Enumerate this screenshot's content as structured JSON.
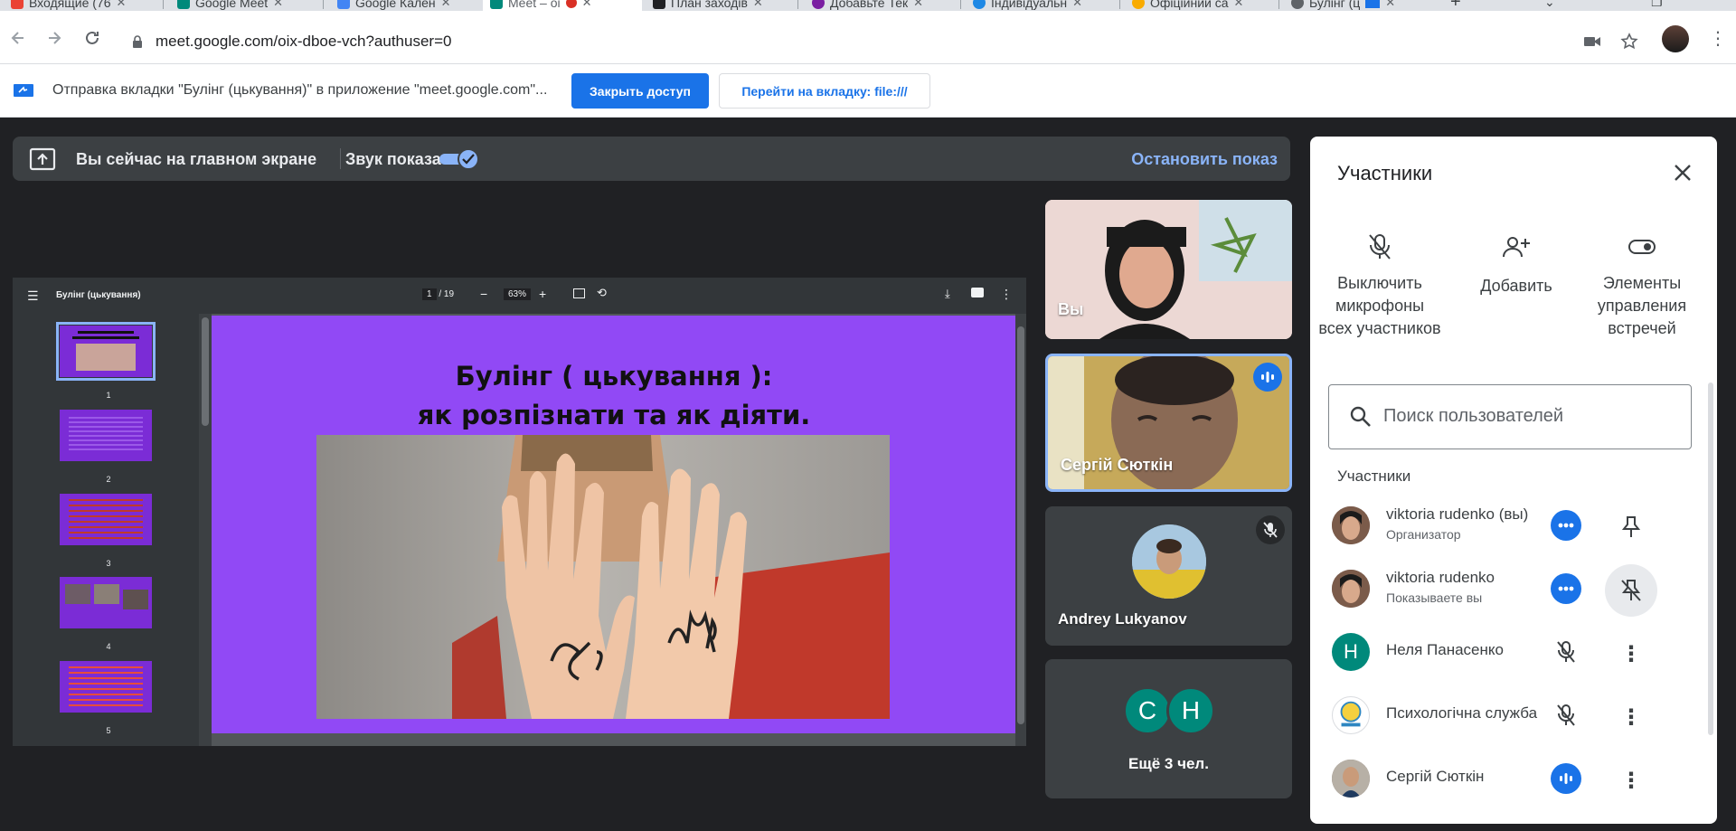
{
  "browser": {
    "tabs": [
      {
        "label": "Входящие (76",
        "color": "#ea4335"
      },
      {
        "label": "Google Meet",
        "color": "#00897b"
      },
      {
        "label": "Google Кален",
        "color": "#4285f4"
      },
      {
        "label": "Meet – oi",
        "color": "#00897b"
      },
      {
        "label": "План заходів",
        "color": "#202124"
      },
      {
        "label": "Добавьте Тек",
        "color": "#7b1fa2"
      },
      {
        "label": "Індивідуальн",
        "color": "#1e88e5"
      },
      {
        "label": "Офіційний са",
        "color": "#f9ab00"
      },
      {
        "label": "Булінг (ц",
        "color": "#5f6368"
      }
    ],
    "url": "meet.google.com/oix-dboe-vch?authuser=0"
  },
  "infobar": {
    "message": "Отправка вкладки \"Булінг (цькування)\" в приложение \"meet.google.com\"...",
    "stop_button": "Закрыть доступ",
    "goto_button": "Перейти на вкладку: file:///"
  },
  "presenting": {
    "status": "Вы сейчас на главном экране",
    "sound_label": "Звук показа",
    "sound_on": true,
    "stop_label": "Остановить показ"
  },
  "pdf": {
    "title": "Булінг (цькування)",
    "current_page": "1",
    "total_pages": "/ 19",
    "zoom": "63%",
    "thumbnails": [
      "1",
      "2",
      "3",
      "4",
      "5"
    ],
    "slide_line1": "Булінг ( цькування ):",
    "slide_line2": "як розпізнати та як діяти."
  },
  "tiles": {
    "me_label": "Вы",
    "speaker_name": "Сергій Сюткін",
    "andrey_name": "Andrey Lukyanov",
    "more_initials": [
      "С",
      "Н"
    ],
    "more_label": "Ещё 3 чел."
  },
  "panel": {
    "title": "Участники",
    "actions": [
      {
        "label": "Выключить микрофоны всех участников"
      },
      {
        "label": "Добавить"
      },
      {
        "label": "Элементы управления встречей"
      }
    ],
    "search_placeholder": "Поиск пользователей",
    "section_label": "Участники",
    "people": [
      {
        "name": "viktoria rudenko (вы)",
        "role": "Организатор"
      },
      {
        "name": "viktoria rudenko",
        "role": "Показываете вы"
      },
      {
        "name": "Неля Панасенко",
        "initial": "Н"
      },
      {
        "name": "Психологічна служба"
      },
      {
        "name": "Сергій Сюткін"
      }
    ]
  }
}
